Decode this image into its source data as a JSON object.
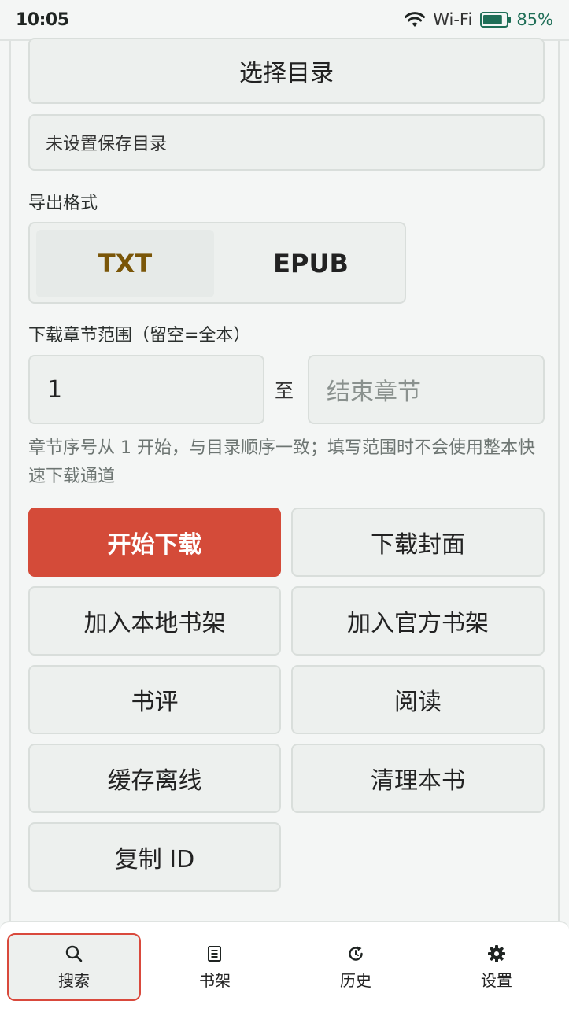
{
  "status_bar": {
    "time": "10:05",
    "wifi_label": "Wi-Fi",
    "battery_percent": "85%",
    "battery_level": 0.85,
    "battery_color": "#1f6e57"
  },
  "directory": {
    "select_label": "选择目录",
    "current_path": "未设置保存目录"
  },
  "format": {
    "label": "导出格式",
    "options": [
      "TXT",
      "EPUB"
    ],
    "selected": "TXT",
    "selected_color": "#7a5608"
  },
  "range": {
    "label": "下载章节范围（留空=全本）",
    "start_value": "1",
    "to_label": "至",
    "end_placeholder": "结束章节",
    "hint": "章节序号从 1 开始，与目录顺序一致；填写范围时不会使用整本快速下载通道"
  },
  "actions": {
    "start_download": "开始下载",
    "download_cover": "下载封面",
    "add_local_shelf": "加入本地书架",
    "add_official_shelf": "加入官方书架",
    "book_review": "书评",
    "read": "阅读",
    "cache_offline": "缓存离线",
    "clear_book": "清理本书",
    "copy_id": "复制 ID",
    "primary_color": "#d44b39"
  },
  "bottom_nav": {
    "items": [
      {
        "label": "搜索",
        "icon": "search-icon",
        "active": true
      },
      {
        "label": "书架",
        "icon": "bookshelf-icon",
        "active": false
      },
      {
        "label": "历史",
        "icon": "history-icon",
        "active": false
      },
      {
        "label": "设置",
        "icon": "gear-icon",
        "active": false
      }
    ]
  }
}
